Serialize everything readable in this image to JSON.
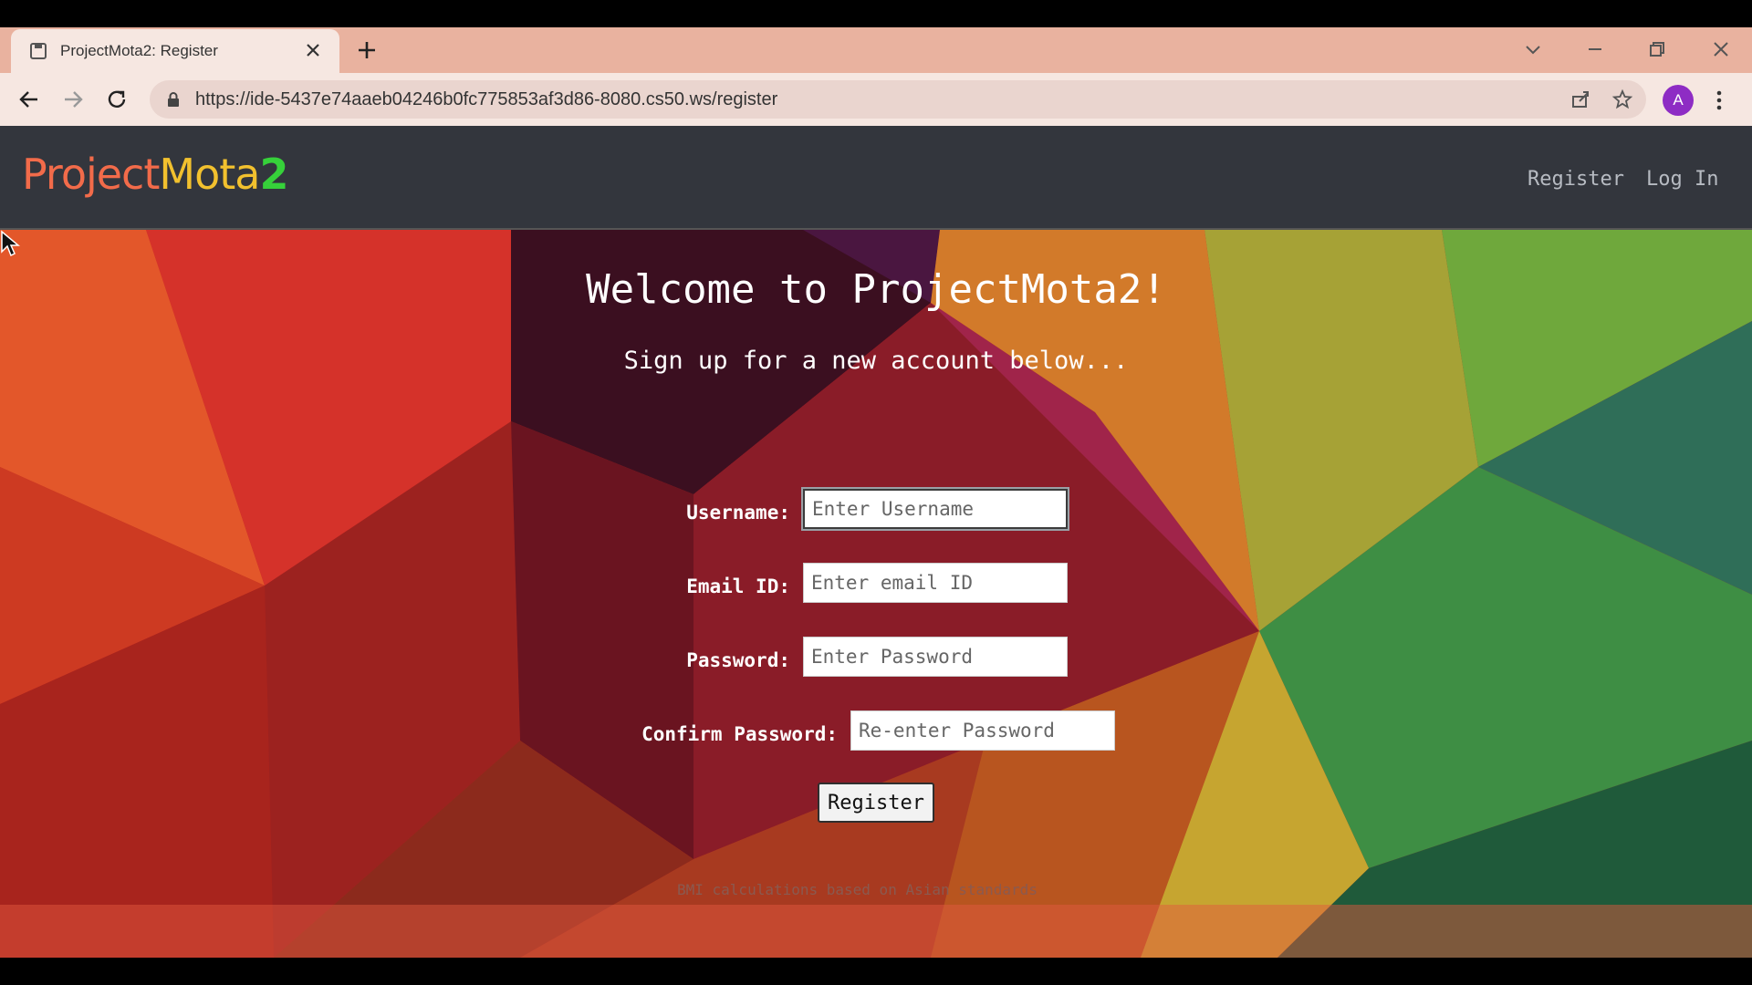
{
  "browser": {
    "tab_title": "ProjectMota2: Register",
    "url": "https://ide-5437e74aaeb04246b0fc775853af3d86-8080.cs50.ws/register",
    "profile_initial": "A"
  },
  "site": {
    "logo": {
      "part1": "Project",
      "part2": "Mota",
      "part3": "2"
    },
    "nav": {
      "register": "Register",
      "login": "Log In"
    }
  },
  "main": {
    "heading": "Welcome to ProjectMota2!",
    "subheading": "Sign up for a new account below...",
    "fields": {
      "username": {
        "label": "Username:",
        "placeholder": "Enter Username"
      },
      "email": {
        "label": "Email ID:",
        "placeholder": "Enter email ID"
      },
      "password": {
        "label": "Password:",
        "placeholder": "Enter Password"
      },
      "confirm": {
        "label": "Confirm Password:",
        "placeholder": "Re-enter Password"
      }
    },
    "submit_label": "Register",
    "footer_note": "BMI calculations based on Asian standards"
  },
  "colors": {
    "navbar_bg": "#33363d",
    "logo_red": "#f26b4a",
    "logo_yellow": "#f2c12e",
    "logo_green": "#36d13a",
    "tab_strip": "#e9b29f"
  }
}
